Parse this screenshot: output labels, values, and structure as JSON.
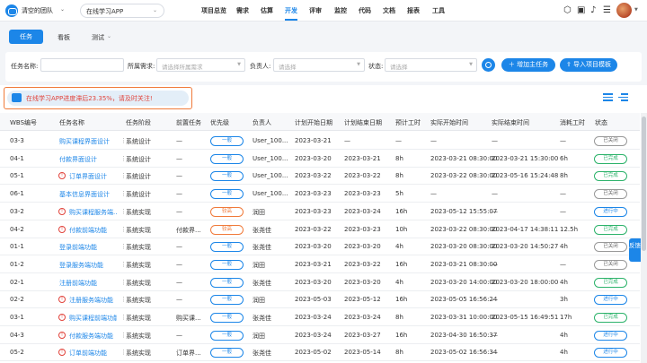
{
  "header": {
    "team": "清空的团队",
    "project": "在线学习APP",
    "nav": [
      "项目总览",
      "需求",
      "估算",
      "开发",
      "评审",
      "监控",
      "代码",
      "文档",
      "报表",
      "工具"
    ],
    "active_nav": "开发",
    "icons": [
      "cube-icon",
      "briefcase-icon",
      "bell-icon",
      "sliders-icon",
      "avatar"
    ]
  },
  "tabs": {
    "task": "任务",
    "kanban": "看板",
    "test": "测试"
  },
  "filters": {
    "task_name_label": "任务名称:",
    "req_label": "所属需求:",
    "req_placeholder": "请选择所属需求",
    "owner_label": "负责人:",
    "owner_placeholder": "请选择",
    "status_label": "状态:",
    "status_placeholder": "请选择",
    "add_main_task": "增加主任务",
    "import_template": "导入项目模板"
  },
  "alert": "在线学习APP进度滞后23.35%，请及时关注!",
  "colors": {
    "accent": "#1c86e8",
    "warning": "#f07a3a",
    "danger": "#e1433b",
    "success": "#2db36b"
  },
  "columns": [
    "WBS编号",
    "任务名称",
    "任务阶段",
    "前置任务",
    "优先级",
    "负责人",
    "计划开始日期",
    "计划结束日期",
    "预计工时",
    "实际开始时间",
    "实际结束时间",
    "消耗工时",
    "状态"
  ],
  "rows": [
    {
      "wbs": "03-3",
      "name": "购买课程界面设计",
      "flag": false,
      "stage": "系统设计",
      "pre": "—",
      "prio": "一般",
      "hi": false,
      "owner": "User_100...",
      "ps": "2023-03-21",
      "pe": "—",
      "est": "—",
      "as": "—",
      "ae": "—",
      "used": "—",
      "status": "已关闭",
      "st": "closed"
    },
    {
      "wbs": "04-1",
      "name": "付款界面设计",
      "flag": false,
      "stage": "系统设计",
      "pre": "—",
      "prio": "一般",
      "hi": false,
      "owner": "User_100...",
      "ps": "2023-03-20",
      "pe": "2023-03-21",
      "est": "8h",
      "as": "2023-03-21 08:30:00",
      "ae": "2023-03-21 15:30:00",
      "used": "6h",
      "status": "已完成",
      "st": "done"
    },
    {
      "wbs": "05-1",
      "name": "订单界面设计",
      "flag": true,
      "stage": "系统设计",
      "pre": "—",
      "prio": "一般",
      "hi": false,
      "owner": "User_100...",
      "ps": "2023-03-22",
      "pe": "2023-03-22",
      "est": "8h",
      "as": "2023-03-22 08:30:00",
      "ae": "2023-05-16 15:24:48",
      "used": "8h",
      "status": "已完成",
      "st": "done"
    },
    {
      "wbs": "06-1",
      "name": "基本信息界面设计",
      "flag": false,
      "stage": "系统设计",
      "pre": "—",
      "prio": "一般",
      "hi": false,
      "owner": "User_100...",
      "ps": "2023-03-23",
      "pe": "2023-03-23",
      "est": "5h",
      "as": "—",
      "ae": "—",
      "used": "—",
      "status": "已关闭",
      "st": "closed"
    },
    {
      "wbs": "03-2",
      "name": "购买课程服务端...",
      "flag": true,
      "stage": "系统实现",
      "pre": "—",
      "prio": "较高",
      "hi": true,
      "owner": "润田",
      "ps": "2023-03-23",
      "pe": "2023-03-24",
      "est": "16h",
      "as": "2023-05-12 15:55:07",
      "ae": "—",
      "used": "—",
      "status": "进行中",
      "st": "prog"
    },
    {
      "wbs": "04-2",
      "name": "付款前端功能",
      "flag": true,
      "stage": "系统实现",
      "pre": "付款界...",
      "prio": "较高",
      "hi": true,
      "owner": "张尧佳",
      "ps": "2023-03-22",
      "pe": "2023-03-23",
      "est": "10h",
      "as": "2023-03-22 08:30:00",
      "ae": "2023-04-17 14:38:11",
      "used": "12.5h",
      "status": "已完成",
      "st": "done"
    },
    {
      "wbs": "01-1",
      "name": "登录前端功能",
      "flag": false,
      "stage": "系统实现",
      "pre": "—",
      "prio": "一般",
      "hi": false,
      "owner": "张尧佳",
      "ps": "2023-03-20",
      "pe": "2023-03-20",
      "est": "4h",
      "as": "2023-03-20 08:30:00",
      "ae": "2023-03-20 14:50:27",
      "used": "4h",
      "status": "已关闭",
      "st": "closed"
    },
    {
      "wbs": "01-2",
      "name": "登录服务端功能",
      "flag": false,
      "stage": "系统实现",
      "pre": "—",
      "prio": "一般",
      "hi": false,
      "owner": "润田",
      "ps": "2023-03-21",
      "pe": "2023-03-22",
      "est": "16h",
      "as": "2023-03-21 08:30:00",
      "ae": "—",
      "used": "—",
      "status": "已关闭",
      "st": "closed"
    },
    {
      "wbs": "02-1",
      "name": "注册前端功能",
      "flag": false,
      "stage": "系统实现",
      "pre": "—",
      "prio": "一般",
      "hi": false,
      "owner": "张尧佳",
      "ps": "2023-03-20",
      "pe": "2023-03-20",
      "est": "4h",
      "as": "2023-03-20 14:00:00",
      "ae": "2023-03-20 18:00:00",
      "used": "4h",
      "status": "已完成",
      "st": "done"
    },
    {
      "wbs": "02-2",
      "name": "注册服务端功能",
      "flag": true,
      "stage": "系统实现",
      "pre": "—",
      "prio": "一般",
      "hi": false,
      "owner": "润田",
      "ps": "2023-05-03",
      "pe": "2023-05-12",
      "est": "16h",
      "as": "2023-05-05 16:56:24",
      "ae": "—",
      "used": "3h",
      "status": "进行中",
      "st": "prog"
    },
    {
      "wbs": "03-1",
      "name": "购买课程前端功能",
      "flag": true,
      "stage": "系统实现",
      "pre": "购买课...",
      "prio": "一般",
      "hi": false,
      "owner": "张尧佳",
      "ps": "2023-03-24",
      "pe": "2023-03-24",
      "est": "8h",
      "as": "2023-03-31 10:00:00",
      "ae": "2023-05-15 16:49:51",
      "used": "17h",
      "status": "已完成",
      "st": "done"
    },
    {
      "wbs": "04-3",
      "name": "付款服务端功能",
      "flag": true,
      "stage": "系统实现",
      "pre": "—",
      "prio": "一般",
      "hi": false,
      "owner": "润田",
      "ps": "2023-03-24",
      "pe": "2023-03-27",
      "est": "16h",
      "as": "2023-04-30 16:50:37",
      "ae": "—",
      "used": "4h",
      "status": "进行中",
      "st": "prog"
    },
    {
      "wbs": "05-2",
      "name": "订单前端功能",
      "flag": true,
      "stage": "系统实现",
      "pre": "订单界...",
      "prio": "一般",
      "hi": false,
      "owner": "张尧佳",
      "ps": "2023-05-02",
      "pe": "2023-05-14",
      "est": "8h",
      "as": "2023-05-02 16:56:34",
      "ae": "—",
      "used": "4h",
      "status": "进行中",
      "st": "prog"
    }
  ],
  "feedback": "反馈"
}
